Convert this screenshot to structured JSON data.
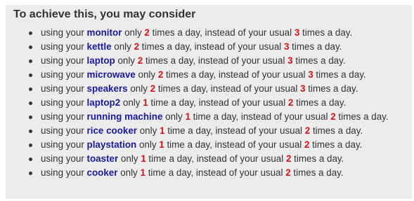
{
  "panel": {
    "title": "To achieve this, you may consider"
  },
  "colors": {
    "panel_background": "#ececec",
    "text": "#333333",
    "device_highlight": "#1a1aa0",
    "number_highlight": "#dd1111"
  },
  "suggestions": [
    {
      "prefix": "using your",
      "device": "monitor",
      "mid1": "only",
      "new_times": "2",
      "mid2": "times a day, instead of your usual",
      "usual_times": "3",
      "suffix": "times a day."
    },
    {
      "prefix": "using your",
      "device": "kettle",
      "mid1": "only",
      "new_times": "2",
      "mid2": "times a day, instead of your usual",
      "usual_times": "3",
      "suffix": "times a day."
    },
    {
      "prefix": "using your",
      "device": "laptop",
      "mid1": "only",
      "new_times": "2",
      "mid2": "times a day, instead of your usual",
      "usual_times": "3",
      "suffix": "times a day."
    },
    {
      "prefix": "using your",
      "device": "microwave",
      "mid1": "only",
      "new_times": "2",
      "mid2": "times a day, instead of your usual",
      "usual_times": "3",
      "suffix": "times a day."
    },
    {
      "prefix": "using your",
      "device": "speakers",
      "mid1": "only",
      "new_times": "2",
      "mid2": "times a day, instead of your usual",
      "usual_times": "3",
      "suffix": "times a day."
    },
    {
      "prefix": "using your",
      "device": "laptop2",
      "mid1": "only",
      "new_times": "1",
      "mid2": "time a day, instead of your usual",
      "usual_times": "2",
      "suffix": "times a day."
    },
    {
      "prefix": "using your",
      "device": "running machine",
      "mid1": "only",
      "new_times": "1",
      "mid2": "time a day, instead of your usual",
      "usual_times": "2",
      "suffix": "times a day."
    },
    {
      "prefix": "using your",
      "device": "rice cooker",
      "mid1": "only",
      "new_times": "1",
      "mid2": "time a day, instead of your usual",
      "usual_times": "2",
      "suffix": "times a day."
    },
    {
      "prefix": "using your",
      "device": "playstation",
      "mid1": "only",
      "new_times": "1",
      "mid2": "time a day, instead of your usual",
      "usual_times": "2",
      "suffix": "times a day."
    },
    {
      "prefix": "using your",
      "device": "toaster",
      "mid1": "only",
      "new_times": "1",
      "mid2": "time a day, instead of your usual",
      "usual_times": "2",
      "suffix": "times a day."
    },
    {
      "prefix": "using your",
      "device": "cooker",
      "mid1": "only",
      "new_times": "1",
      "mid2": "time a day, instead of your usual",
      "usual_times": "2",
      "suffix": "times a day."
    }
  ]
}
